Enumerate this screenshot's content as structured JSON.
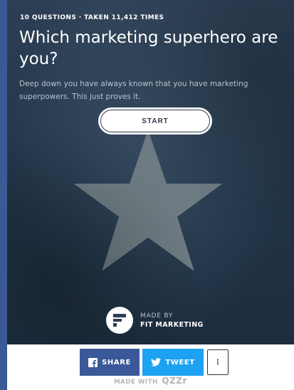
{
  "quiz": {
    "meta": "10 QUESTIONS · TAKEN 11,412 TIMES",
    "title": "Which marketing superhero are you?",
    "description": "Deep down you have always known that you have marketing superpowers. This just proves it.",
    "start_label": "START"
  },
  "creator": {
    "made_by_label": "MADE BY",
    "name": "FIT MARKETING"
  },
  "share": {
    "share_label": "SHARE",
    "tweet_label": "TWEET",
    "more_label": "⋮",
    "made_with_label": "MADE WITH",
    "brand": "QZZr"
  },
  "icons": [
    "star-icon",
    "fit-marketing-logo-icon",
    "facebook-icon",
    "twitter-icon",
    "more-vertical-icon"
  ],
  "colors": {
    "hero_bg": "#223447",
    "facebook": "#3b5998",
    "twitter": "#1da1f2",
    "page_edge": "#3a5a96"
  }
}
